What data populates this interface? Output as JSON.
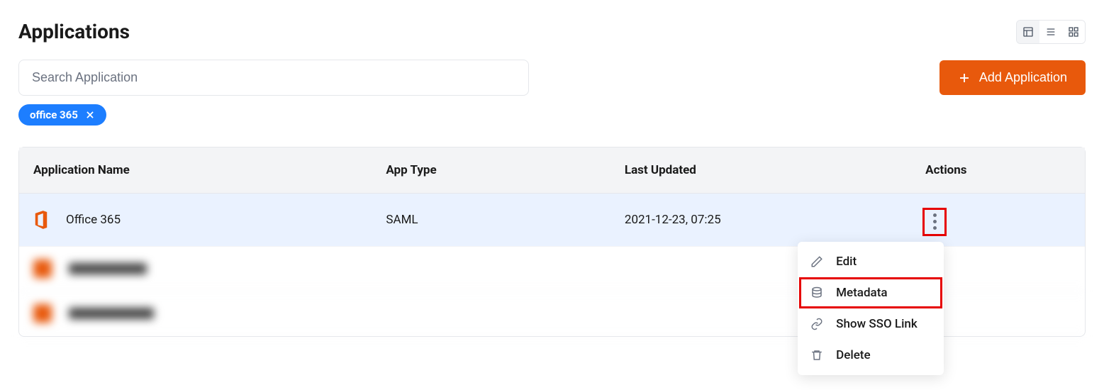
{
  "page": {
    "title": "Applications"
  },
  "search": {
    "placeholder": "Search Application"
  },
  "filter": {
    "chip_label": "office 365"
  },
  "actions": {
    "add_label": "Add Application"
  },
  "table": {
    "headers": {
      "name": "Application Name",
      "type": "App Type",
      "updated": "Last Updated",
      "actions": "Actions"
    },
    "rows": [
      {
        "name": "Office 365",
        "type": "SAML",
        "updated": "2021-12-23, 07:25"
      }
    ]
  },
  "menu": {
    "edit": "Edit",
    "metadata": "Metadata",
    "show_sso": "Show SSO Link",
    "delete": "Delete"
  }
}
